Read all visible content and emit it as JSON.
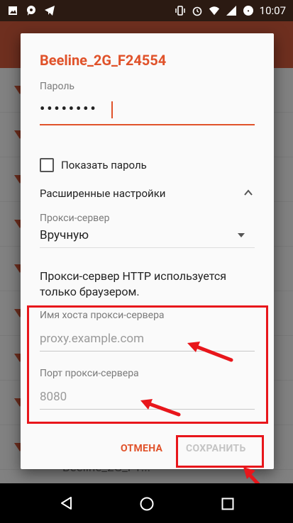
{
  "status_bar": {
    "time": "10:07",
    "left_icons": [
      "image-icon",
      "chat-icon",
      "telegram-icon"
    ],
    "right_icons": [
      "vibrate-icon",
      "alarm-icon",
      "wifi-icon",
      "signal-icon",
      "battery-icon"
    ]
  },
  "dialog": {
    "title": "Beeline_2G_F24554",
    "password_label": "Пароль",
    "password_value": "••••••••",
    "show_password_label": "Показать пароль",
    "show_password_checked": false,
    "advanced_label": "Расширенные настройки",
    "proxy_label": "Прокси-сервер",
    "proxy_value": "Вручную",
    "proxy_note": "Прокси-сервер HTTP используется только браузером.",
    "host_label": "Имя хоста прокси-сервера",
    "host_placeholder": "proxy.example.com",
    "port_label": "Порт прокси-сервера",
    "port_placeholder": "8080",
    "cancel_label": "ОТМЕНА",
    "save_label": "СОХРАНИТЬ"
  },
  "background_item": {
    "label": "Beeline_2G_F1..."
  },
  "colors": {
    "accent": "#e0522a",
    "highlight": "#e8161b"
  }
}
